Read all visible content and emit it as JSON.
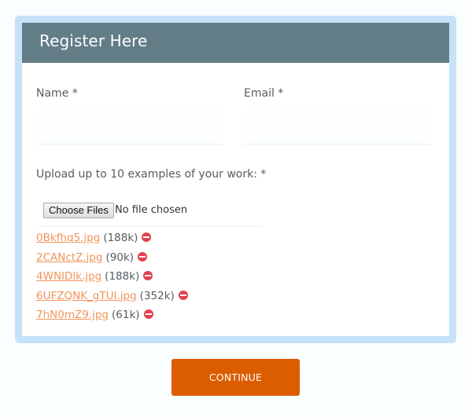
{
  "form": {
    "title": "Register Here",
    "fields": {
      "name": {
        "label": "Name *",
        "value": "",
        "placeholder": ""
      },
      "email": {
        "label": "Email *",
        "value": "",
        "placeholder": ""
      }
    },
    "upload": {
      "label": "Upload up to 10 examples of your work: *",
      "choose_button": "Choose Files",
      "status": "No file chosen",
      "files": [
        {
          "name": "0Bkfhq5.jpg",
          "size": "(188k)"
        },
        {
          "name": "2CANctZ.jpg",
          "size": "(90k)"
        },
        {
          "name": "4WNIDlk.jpg",
          "size": "(188k)"
        },
        {
          "name": "6UFZQNK_gTUI.jpg",
          "size": "(352k)"
        },
        {
          "name": "7hN0mZ9.jpg",
          "size": "(61k)"
        }
      ],
      "remove_icon": "minus-circle"
    },
    "submit_label": "CONTINUE"
  },
  "colors": {
    "header_bg": "#627d86",
    "card_border": "#c6e2f8",
    "link": "#f0955a",
    "remove_icon": "#e2434f",
    "button_bg": "#dc5c00"
  }
}
